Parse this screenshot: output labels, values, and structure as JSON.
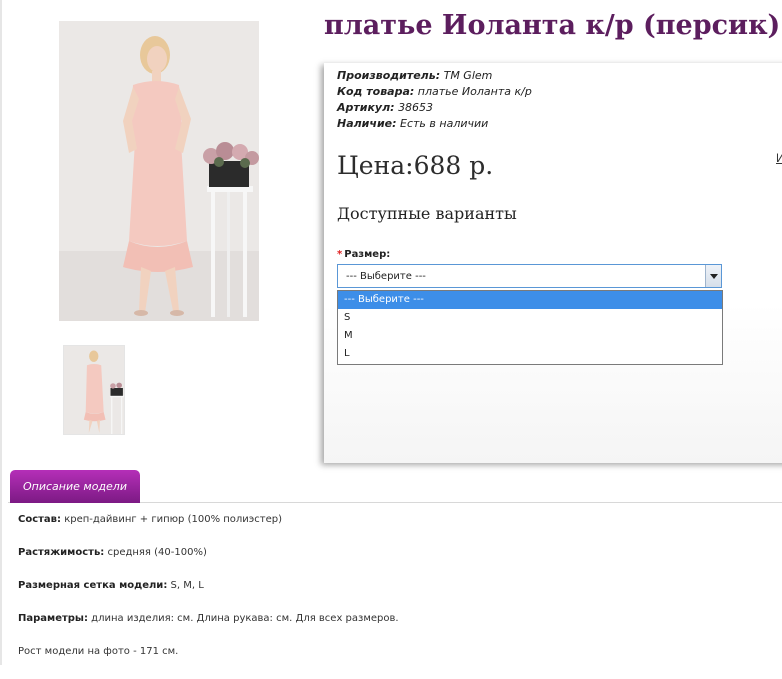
{
  "product": {
    "title": "платье Иоланта к/р (персик)",
    "specs": [
      {
        "label": "Производитель:",
        "value": "ТМ Glem"
      },
      {
        "label": "Код товара:",
        "value": "платье Иоланта к/р"
      },
      {
        "label": "Артикул:",
        "value": "38653"
      },
      {
        "label": "Наличие:",
        "value": "Есть в наличии"
      }
    ],
    "price": "Цена:688 р.",
    "side_link": "И"
  },
  "variants": {
    "heading": "Доступные варианты",
    "required_mark": "*",
    "size_label": "Размер:",
    "selected": "--- Выберите ---",
    "options": [
      "--- Выберите ---",
      "S",
      "M",
      "L"
    ]
  },
  "tabs": {
    "description_label": "Описание модели"
  },
  "description": [
    {
      "label": "Состав:",
      "value": "креп-дайвинг + гипюр (100% полиэстер)"
    },
    {
      "label": "Растяжимость:",
      "value": "средняя (40-100%)"
    },
    {
      "label": "Размерная сетка модели:",
      "value": "S, M, L"
    },
    {
      "label": "Параметры:",
      "value": "длина изделия: см. Длина рукава: см. Для всех размеров."
    },
    {
      "label": "",
      "value": "Рост модели на фото - 171 см."
    }
  ],
  "colors": {
    "title": "#5c1e5e",
    "tab": "#9a24a0",
    "dropdown_highlight": "#3d8ee8",
    "dress": "#f4c9c0"
  },
  "icons": {
    "select_arrow": "chevron-down-icon"
  }
}
